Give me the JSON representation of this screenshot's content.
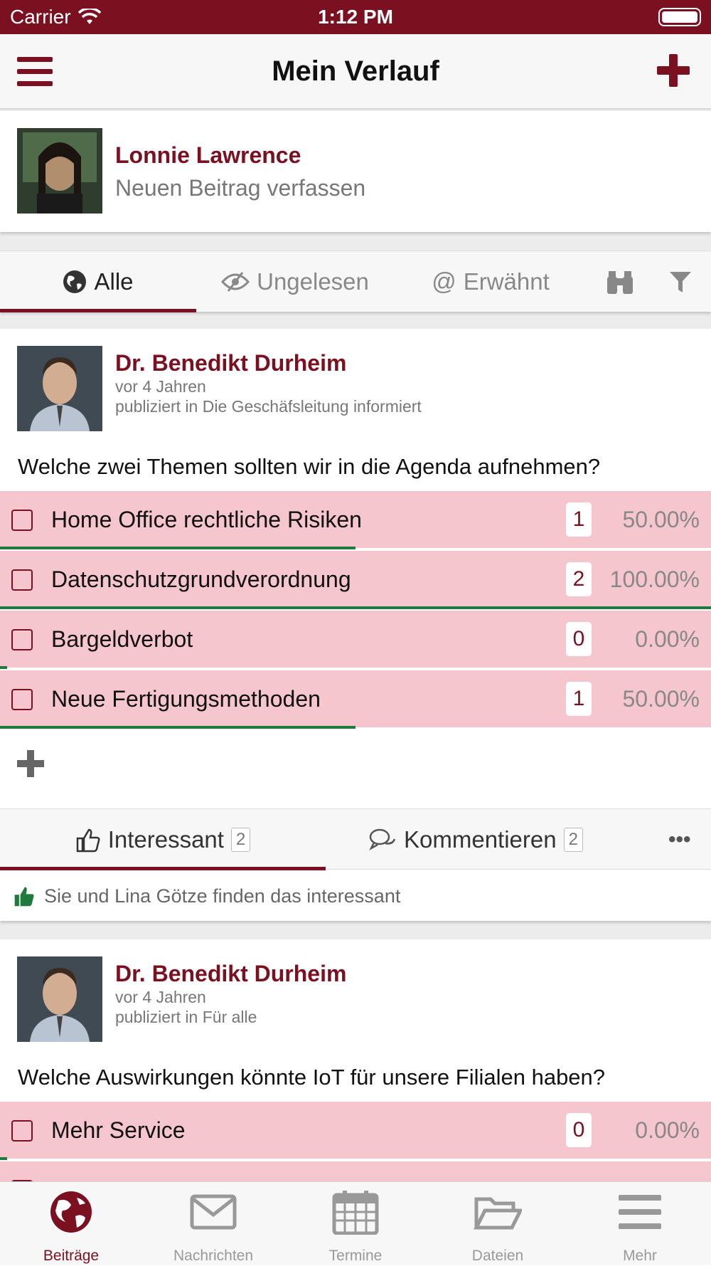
{
  "status_bar": {
    "carrier": "Carrier",
    "time": "1:12 PM"
  },
  "nav": {
    "title": "Mein Verlauf"
  },
  "composer": {
    "user_name": "Lonnie Lawrence",
    "prompt": "Neuen Beitrag verfassen"
  },
  "filters": [
    {
      "label": "Alle",
      "icon": "globe-icon",
      "active": true
    },
    {
      "label": "Ungelesen",
      "icon": "eye-slash-icon",
      "active": false
    },
    {
      "label": "Erwähnt",
      "icon": "at-icon",
      "active": false
    }
  ],
  "posts": [
    {
      "author": "Dr. Benedikt Durheim",
      "time": "vor 4 Jahren",
      "published_in": "publiziert in Die Geschäfsleitung informiert",
      "question": "Welche zwei Themen sollten wir in die Agenda aufnehmen?",
      "options": [
        {
          "label": "Home Office rechtliche Risiken",
          "count": "1",
          "percent": "50.00%",
          "fill": 0.5
        },
        {
          "label": "Datenschutzgrundverordnung",
          "count": "2",
          "percent": "100.00%",
          "fill": 1.0
        },
        {
          "label": "Bargeldverbot",
          "count": "0",
          "percent": "0.00%",
          "fill": 0.0
        },
        {
          "label": "Neue Fertigungsmethoden",
          "count": "1",
          "percent": "50.00%",
          "fill": 0.5
        }
      ],
      "answer_placeholder": "Antwort hinzufügen",
      "actions": {
        "like_label": "Interessant",
        "like_count": "2",
        "comment_label": "Kommentieren",
        "comment_count": "2"
      },
      "likes_text": "Sie und Lina Götze finden das interessant"
    },
    {
      "author": "Dr. Benedikt Durheim",
      "time": "vor 4 Jahren",
      "published_in": "publiziert in Für alle",
      "question": "Welche Auswirkungen könnte IoT für unsere Filialen haben?",
      "options": [
        {
          "label": "Mehr Service",
          "count": "0",
          "percent": "0.00%",
          "fill": 0.0
        }
      ]
    }
  ],
  "tabbar": [
    {
      "label": "Beiträge",
      "icon": "globe-icon",
      "active": true
    },
    {
      "label": "Nachrichten",
      "icon": "envelope-icon",
      "active": false
    },
    {
      "label": "Termine",
      "icon": "calendar-icon",
      "active": false
    },
    {
      "label": "Dateien",
      "icon": "folder-open-icon",
      "active": false
    },
    {
      "label": "Mehr",
      "icon": "menu-icon",
      "active": false
    }
  ],
  "colors": {
    "brand": "#7b1021",
    "option_bg": "#f5c6cd",
    "vote_bar": "#1f7a3c",
    "like_icon": "#1f7a3c"
  }
}
